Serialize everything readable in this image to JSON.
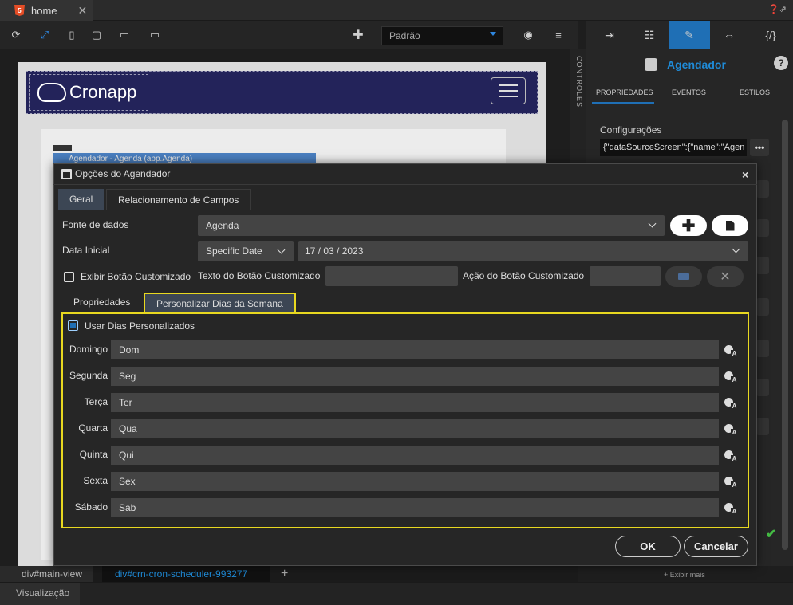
{
  "tabbar": {
    "tab_label": "home",
    "close": "✕",
    "help": "❓⇗"
  },
  "toolbar": {
    "device_select": "Padrão"
  },
  "canvas": {
    "logo_text": "Cronapp",
    "component_label": "Agendador - Agenda (app.Agenda)"
  },
  "controles": {
    "label": "CONTROLES"
  },
  "right_panel": {
    "title": "Agendador",
    "help": "?",
    "subtabs": [
      "PROPRIEDADES",
      "EVENTOS",
      "ESTILOS"
    ],
    "config_label": "Configurações",
    "config_value": "{\"dataSourceScreen\":{\"name\":\"Agen",
    "config_button": "•••",
    "more_link": "+ Exibir mais"
  },
  "modal": {
    "title": "Opções do Agendador",
    "close": "×",
    "tabs": [
      "Geral",
      "Relacionamento de Campos"
    ],
    "fonte_label": "Fonte de dados",
    "fonte_value": "Agenda",
    "data_label": "Data Inicial",
    "data_type": "Specific Date",
    "data_value": "17 / 03 / 2023",
    "exibir_label": "Exibir Botão Customizado",
    "texto_label": "Texto do Botão Customizado",
    "acao_label": "Ação do Botão Customizado",
    "inner_tabs": [
      "Propriedades",
      "Personalizar Dias da Semana"
    ],
    "usar_label": "Usar Dias Personalizados",
    "days": [
      {
        "label": "Domingo",
        "value": "Dom"
      },
      {
        "label": "Segunda",
        "value": "Seg"
      },
      {
        "label": "Terça",
        "value": "Ter"
      },
      {
        "label": "Quarta",
        "value": "Qua"
      },
      {
        "label": "Quinta",
        "value": "Qui"
      },
      {
        "label": "Sexta",
        "value": "Sex"
      },
      {
        "label": "Sábado",
        "value": "Sab"
      }
    ],
    "ok": "OK",
    "cancel": "Cancelar"
  },
  "breadcrumbs": [
    "div#main-view",
    "div#crn-cron-scheduler-993277"
  ],
  "breadcrumb_add": "+",
  "footer": {
    "label": "Visualização"
  },
  "colors": {
    "accent": "#1f6fb5",
    "highlight": "#e8d820",
    "link": "#1f8ad6"
  }
}
